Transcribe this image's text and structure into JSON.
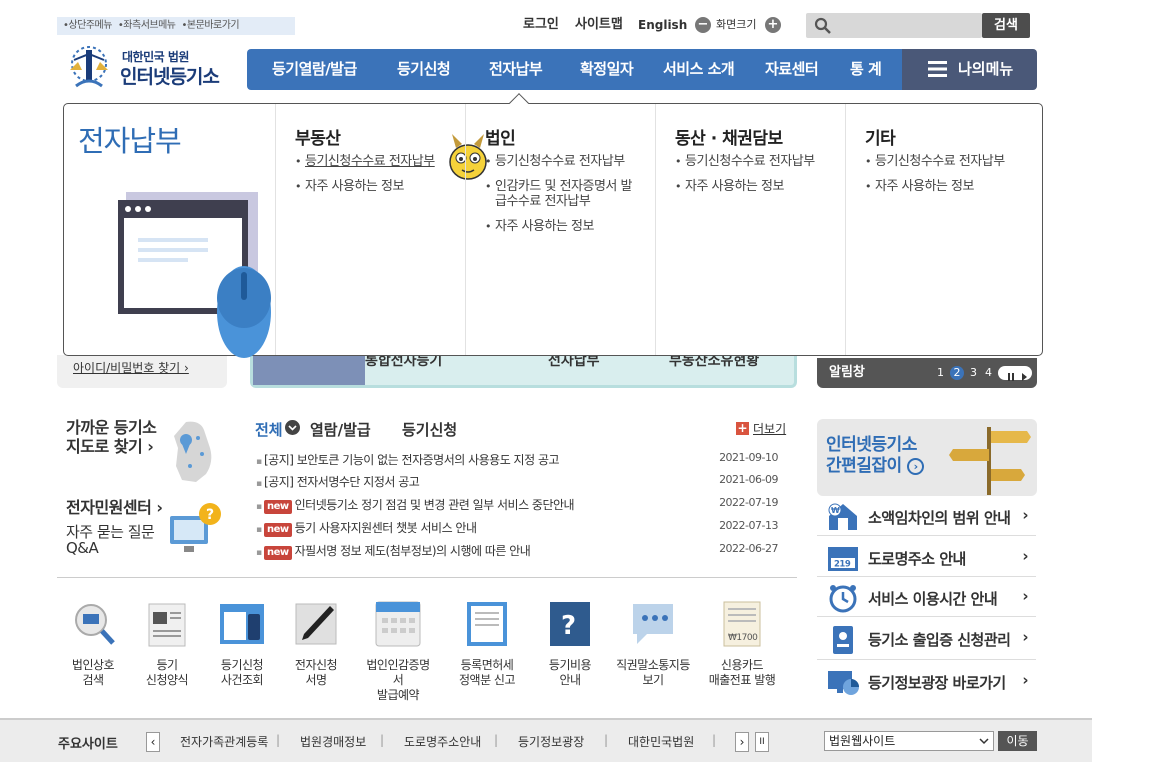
{
  "skip_links": [
    "•상단주메뉴",
    "•좌측서브메뉴",
    "•본문바로가기"
  ],
  "logo": {
    "line1": "대한민국 법원",
    "line2": "인터넷등기소"
  },
  "util": {
    "login": "로그인",
    "sitemap": "사이트맵",
    "english": "English",
    "zoom_label": "화면크기",
    "zoom_out": "−",
    "zoom_in": "+"
  },
  "search": {
    "placeholder": "",
    "button": "검색"
  },
  "gnb": [
    "등기열람/발급",
    "등기신청",
    "전자납부",
    "확정일자",
    "서비스 소개",
    "자료센터",
    "통 계"
  ],
  "mymenu": "나의메뉴",
  "panel": {
    "title": "전자납부",
    "columns": [
      {
        "heading": "부동산",
        "items": [
          "등기신청수수료 전자납부",
          "자주 사용하는 정보"
        ]
      },
      {
        "heading": "법인",
        "items": [
          "등기신청수수료 전자납부",
          "인감카드 및 전자증명서 발급수수료 전자납부",
          "자주 사용하는 정보"
        ]
      },
      {
        "heading": "동산 · 채권담보",
        "items": [
          "등기신청수수료 전자납부",
          "자주 사용하는 정보"
        ]
      },
      {
        "heading": "기타",
        "items": [
          "등기신청수수료 전자납부",
          "자주 사용하는 정보"
        ]
      }
    ]
  },
  "behind": {
    "find_account": "아이디/비밀번호 찾기 ›",
    "quick": [
      "통합전자등기",
      "전자납부",
      "부동산소유현황"
    ],
    "alarm": {
      "label": "알림창",
      "pages": [
        "1",
        "2",
        "3",
        "4"
      ],
      "current": "2"
    }
  },
  "left": {
    "map": {
      "line1": "가까운 등기소",
      "line2": "지도로 찾기 ›"
    },
    "center": "전자민원센터 ›",
    "faq": {
      "line1": "자주 묻는 질문",
      "line2": "Q&A"
    }
  },
  "notices": {
    "tabs": [
      "전체",
      "열람/발급",
      "등기신청"
    ],
    "more": "더보기",
    "new_label": "new",
    "items": [
      {
        "title": "[공지] 보안토큰 기능이 없는 전자증명서의 사용용도 지정 공고",
        "date": "2021-09-10",
        "is_new": false
      },
      {
        "title": "[공지] 전자서명수단 지정서 공고",
        "date": "2021-06-09",
        "is_new": false
      },
      {
        "title": "인터넷등기소 정기 점검 및 변경 관련 일부 서비스 중단안내",
        "date": "2022-07-19",
        "is_new": true
      },
      {
        "title": "등기 사용자지원센터 챗봇 서비스 안내",
        "date": "2022-07-13",
        "is_new": true
      },
      {
        "title": "자필서명 정보 제도(첨부정보)의 시행에 따른 안내",
        "date": "2022-06-27",
        "is_new": true
      }
    ]
  },
  "quick_icons": [
    {
      "l1": "법인상호",
      "l2": "검색",
      "icon": "magnifier-icon"
    },
    {
      "l1": "등기",
      "l2": "신청양식",
      "icon": "form-document-icon"
    },
    {
      "l1": "등기신청",
      "l2": "사건조회",
      "icon": "tablet-icon"
    },
    {
      "l1": "전자신청",
      "l2": "서명",
      "icon": "pen-icon"
    },
    {
      "l1": "법인인감증명서",
      "l2": "발급예약",
      "icon": "calendar-icon"
    },
    {
      "l1": "등록면허세",
      "l2": "정액분 신고",
      "icon": "receipt-icon"
    },
    {
      "l1": "등기비용",
      "l2": "안내",
      "icon": "question-book-icon"
    },
    {
      "l1": "직권말소통지등",
      "l2": "보기",
      "icon": "speech-bubble-icon"
    },
    {
      "l1": "신용카드",
      "l2": "매출전표 발행",
      "icon": "card-receipt-icon"
    }
  ],
  "right": {
    "banner": {
      "line1": "인터넷등기소",
      "line2": "간편길잡이"
    },
    "links": [
      {
        "label": "소액임차인의 범위 안내",
        "icon": "house-won-icon"
      },
      {
        "label": "도로명주소 안내",
        "icon": "address-plate-icon"
      },
      {
        "label": "서비스 이용시간 안내",
        "icon": "alarm-clock-icon"
      },
      {
        "label": "등기소 출입증 신청관리",
        "icon": "badge-icon"
      },
      {
        "label": "등기정보광장 바로가기",
        "icon": "chart-monitor-icon"
      }
    ]
  },
  "footer": {
    "label": "주요사이트",
    "sites": [
      "전자가족관계등록",
      "법원경매정보",
      "도로명주소안내",
      "등기정보광장",
      "대한민국법원"
    ],
    "select_value": "법원웹사이트",
    "go": "이동"
  },
  "colors": {
    "primary_blue": "#3b73b9",
    "mymenu": "#4a5878",
    "accent_text": "#2f6db5",
    "new_badge": "#c8453b"
  }
}
